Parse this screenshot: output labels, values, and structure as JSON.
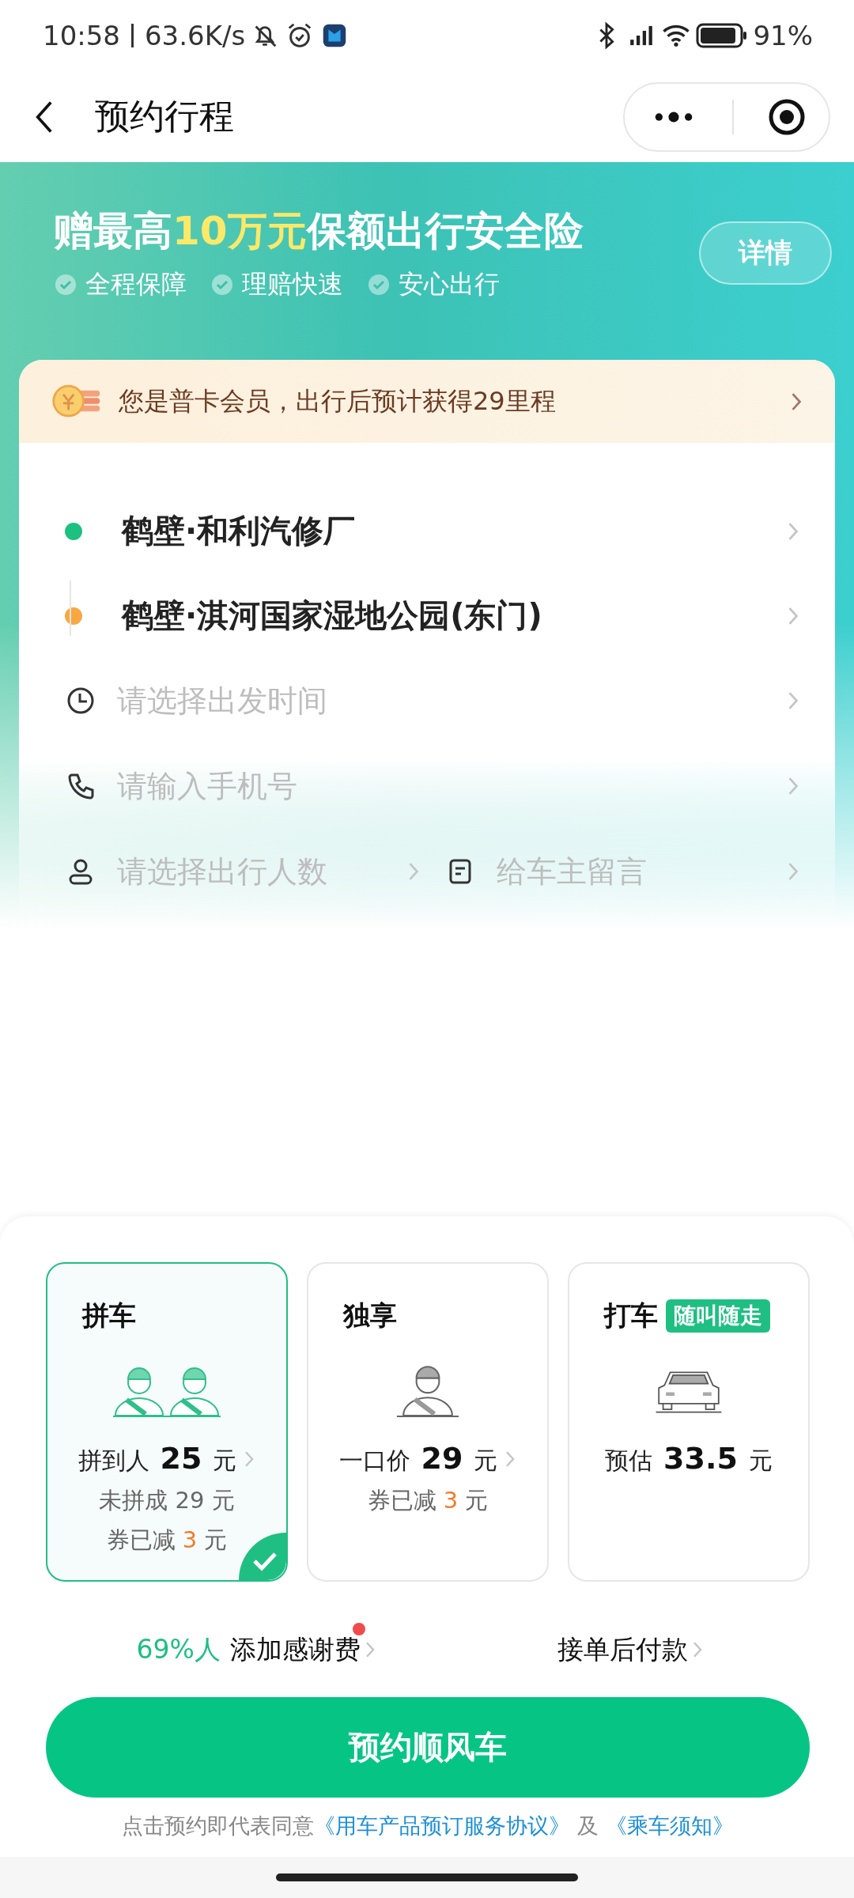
{
  "status_bar": {
    "time": "10:58",
    "speed": "63.6K/s",
    "battery": "91%"
  },
  "nav": {
    "title": "预约行程"
  },
  "banner": {
    "title": [
      {
        "text": "赠最高",
        "highlight": false
      },
      {
        "text": "10万元",
        "highlight": true
      },
      {
        "text": "保额出行安全险",
        "highlight": false
      }
    ],
    "features": [
      "全程保障",
      "理赔快速",
      "安心出行"
    ],
    "button": "详情"
  },
  "member": {
    "text": "您是普卡会员，出行后预计获得29里程"
  },
  "route": [
    {
      "name": "鹤壁·和利汽修厂",
      "color": "#1cc182"
    },
    {
      "name": "鹤壁·淇河国家湿地公园(东门)",
      "color": "#f8a840"
    }
  ],
  "fields": [
    {
      "kind": "time",
      "placeholder": "请选择出发时间"
    },
    {
      "kind": "phone",
      "placeholder": "请输入手机号"
    },
    {
      "kind": "people",
      "placeholder": "请选择出行人数"
    },
    {
      "kind": "note",
      "placeholder": "给车主留言"
    }
  ],
  "options": [
    {
      "kind": "carpool",
      "title": "拼车",
      "selected": true,
      "price_label": "拼到人",
      "price": "25",
      "unit": "元",
      "chevron": true,
      "notes": [
        [
          {
            "text": "未拼成 29 元",
            "highlight": false
          }
        ],
        [
          {
            "text": "券已减 ",
            "highlight": false
          },
          {
            "text": "3",
            "highlight": true
          },
          {
            "text": " 元",
            "highlight": false
          }
        ]
      ]
    },
    {
      "kind": "private",
      "title": "独享",
      "selected": false,
      "price_label": "一口价",
      "price": "29",
      "unit": "元",
      "chevron": true,
      "notes": [
        [
          {
            "text": "券已减 ",
            "highlight": false
          },
          {
            "text": "3",
            "highlight": true
          },
          {
            "text": " 元",
            "highlight": false
          }
        ]
      ]
    },
    {
      "kind": "taxi",
      "title": "打车",
      "badge": "随叫随走",
      "selected": false,
      "price_label": "预估",
      "price": "33.5",
      "unit": "元",
      "chevron": false
    }
  ],
  "extras": {
    "thanks_stat": "69%人",
    "thanks_label": "添加感谢费",
    "thanks_dot": true,
    "payment": "接单后付款"
  },
  "submit": "预约顺风车",
  "terms": {
    "text": "点击预约即代表同意",
    "links": [
      "《用车产品预订服务协议》",
      "《乘车须知》"
    ],
    "joiner": "及"
  }
}
